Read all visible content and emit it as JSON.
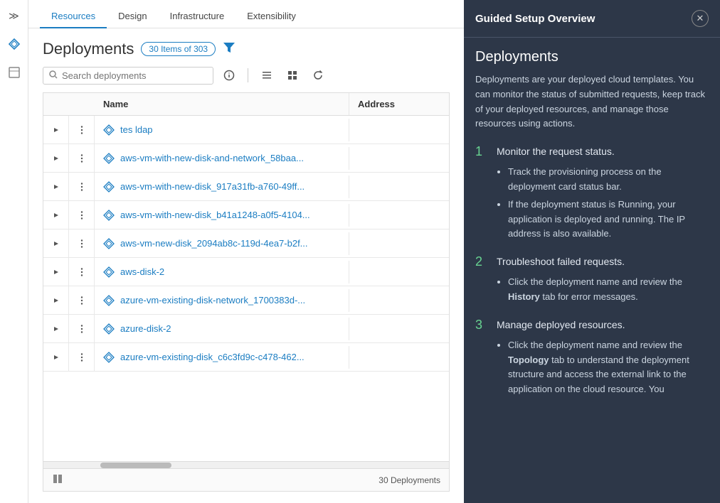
{
  "nav": {
    "tabs": [
      {
        "label": "Resources",
        "active": true
      },
      {
        "label": "Design",
        "active": false
      },
      {
        "label": "Infrastructure",
        "active": false
      },
      {
        "label": "Extensibility",
        "active": false
      }
    ]
  },
  "sidebar": {
    "toggle_icon": "≫",
    "icons": [
      {
        "name": "diamond-nav-icon",
        "symbol": "◈"
      },
      {
        "name": "box-nav-icon",
        "symbol": "⬡"
      }
    ]
  },
  "page": {
    "title": "Deployments",
    "badge": "30 Items of 303",
    "search_placeholder": "Search deployments",
    "toolbar": {
      "info_icon": "ℹ",
      "list_icon": "☰",
      "grid_icon": "⊞",
      "refresh_icon": "↻"
    }
  },
  "table": {
    "columns": [
      {
        "label": "Name"
      },
      {
        "label": "Address"
      }
    ],
    "rows": [
      {
        "name": "tes ldap",
        "address": ""
      },
      {
        "name": "aws-vm-with-new-disk-and-network_58baa...",
        "address": ""
      },
      {
        "name": "aws-vm-with-new-disk_917a31fb-a760-49ff...",
        "address": ""
      },
      {
        "name": "aws-vm-with-new-disk_b41a1248-a0f5-4104...",
        "address": ""
      },
      {
        "name": "aws-vm-new-disk_2094ab8c-119d-4ea7-b2f...",
        "address": ""
      },
      {
        "name": "aws-disk-2",
        "address": ""
      },
      {
        "name": "azure-vm-existing-disk-network_1700383d-...",
        "address": ""
      },
      {
        "name": "azure-disk-2",
        "address": ""
      },
      {
        "name": "azure-vm-existing-disk_c6c3fd9c-c478-462...",
        "address": ""
      }
    ],
    "footer_count": "30 Deployments"
  },
  "guided_setup": {
    "panel_title": "Guided Setup Overview",
    "close_icon": "✕",
    "section_title": "Deployments",
    "description": "Deployments are your deployed cloud templates. You can monitor the status of submitted requests, keep track of your deployed resources, and manage those resources using actions.",
    "steps": [
      {
        "number": "1",
        "title": "Monitor the request status.",
        "bullets": [
          "Track the provisioning process on the deployment card status bar.",
          "If the deployment status is Running, your application is deployed and running. The IP address is also available."
        ]
      },
      {
        "number": "2",
        "title": "Troubleshoot failed requests.",
        "bullets": [
          "Click the deployment name and review the <b>History</b> tab for error messages."
        ]
      },
      {
        "number": "3",
        "title": "Manage deployed resources.",
        "bullets": [
          "Click the deployment name and review the <b>Topology</b> tab to understand the deployment structure and access the external link to the application on the cloud resource. You"
        ]
      }
    ]
  }
}
